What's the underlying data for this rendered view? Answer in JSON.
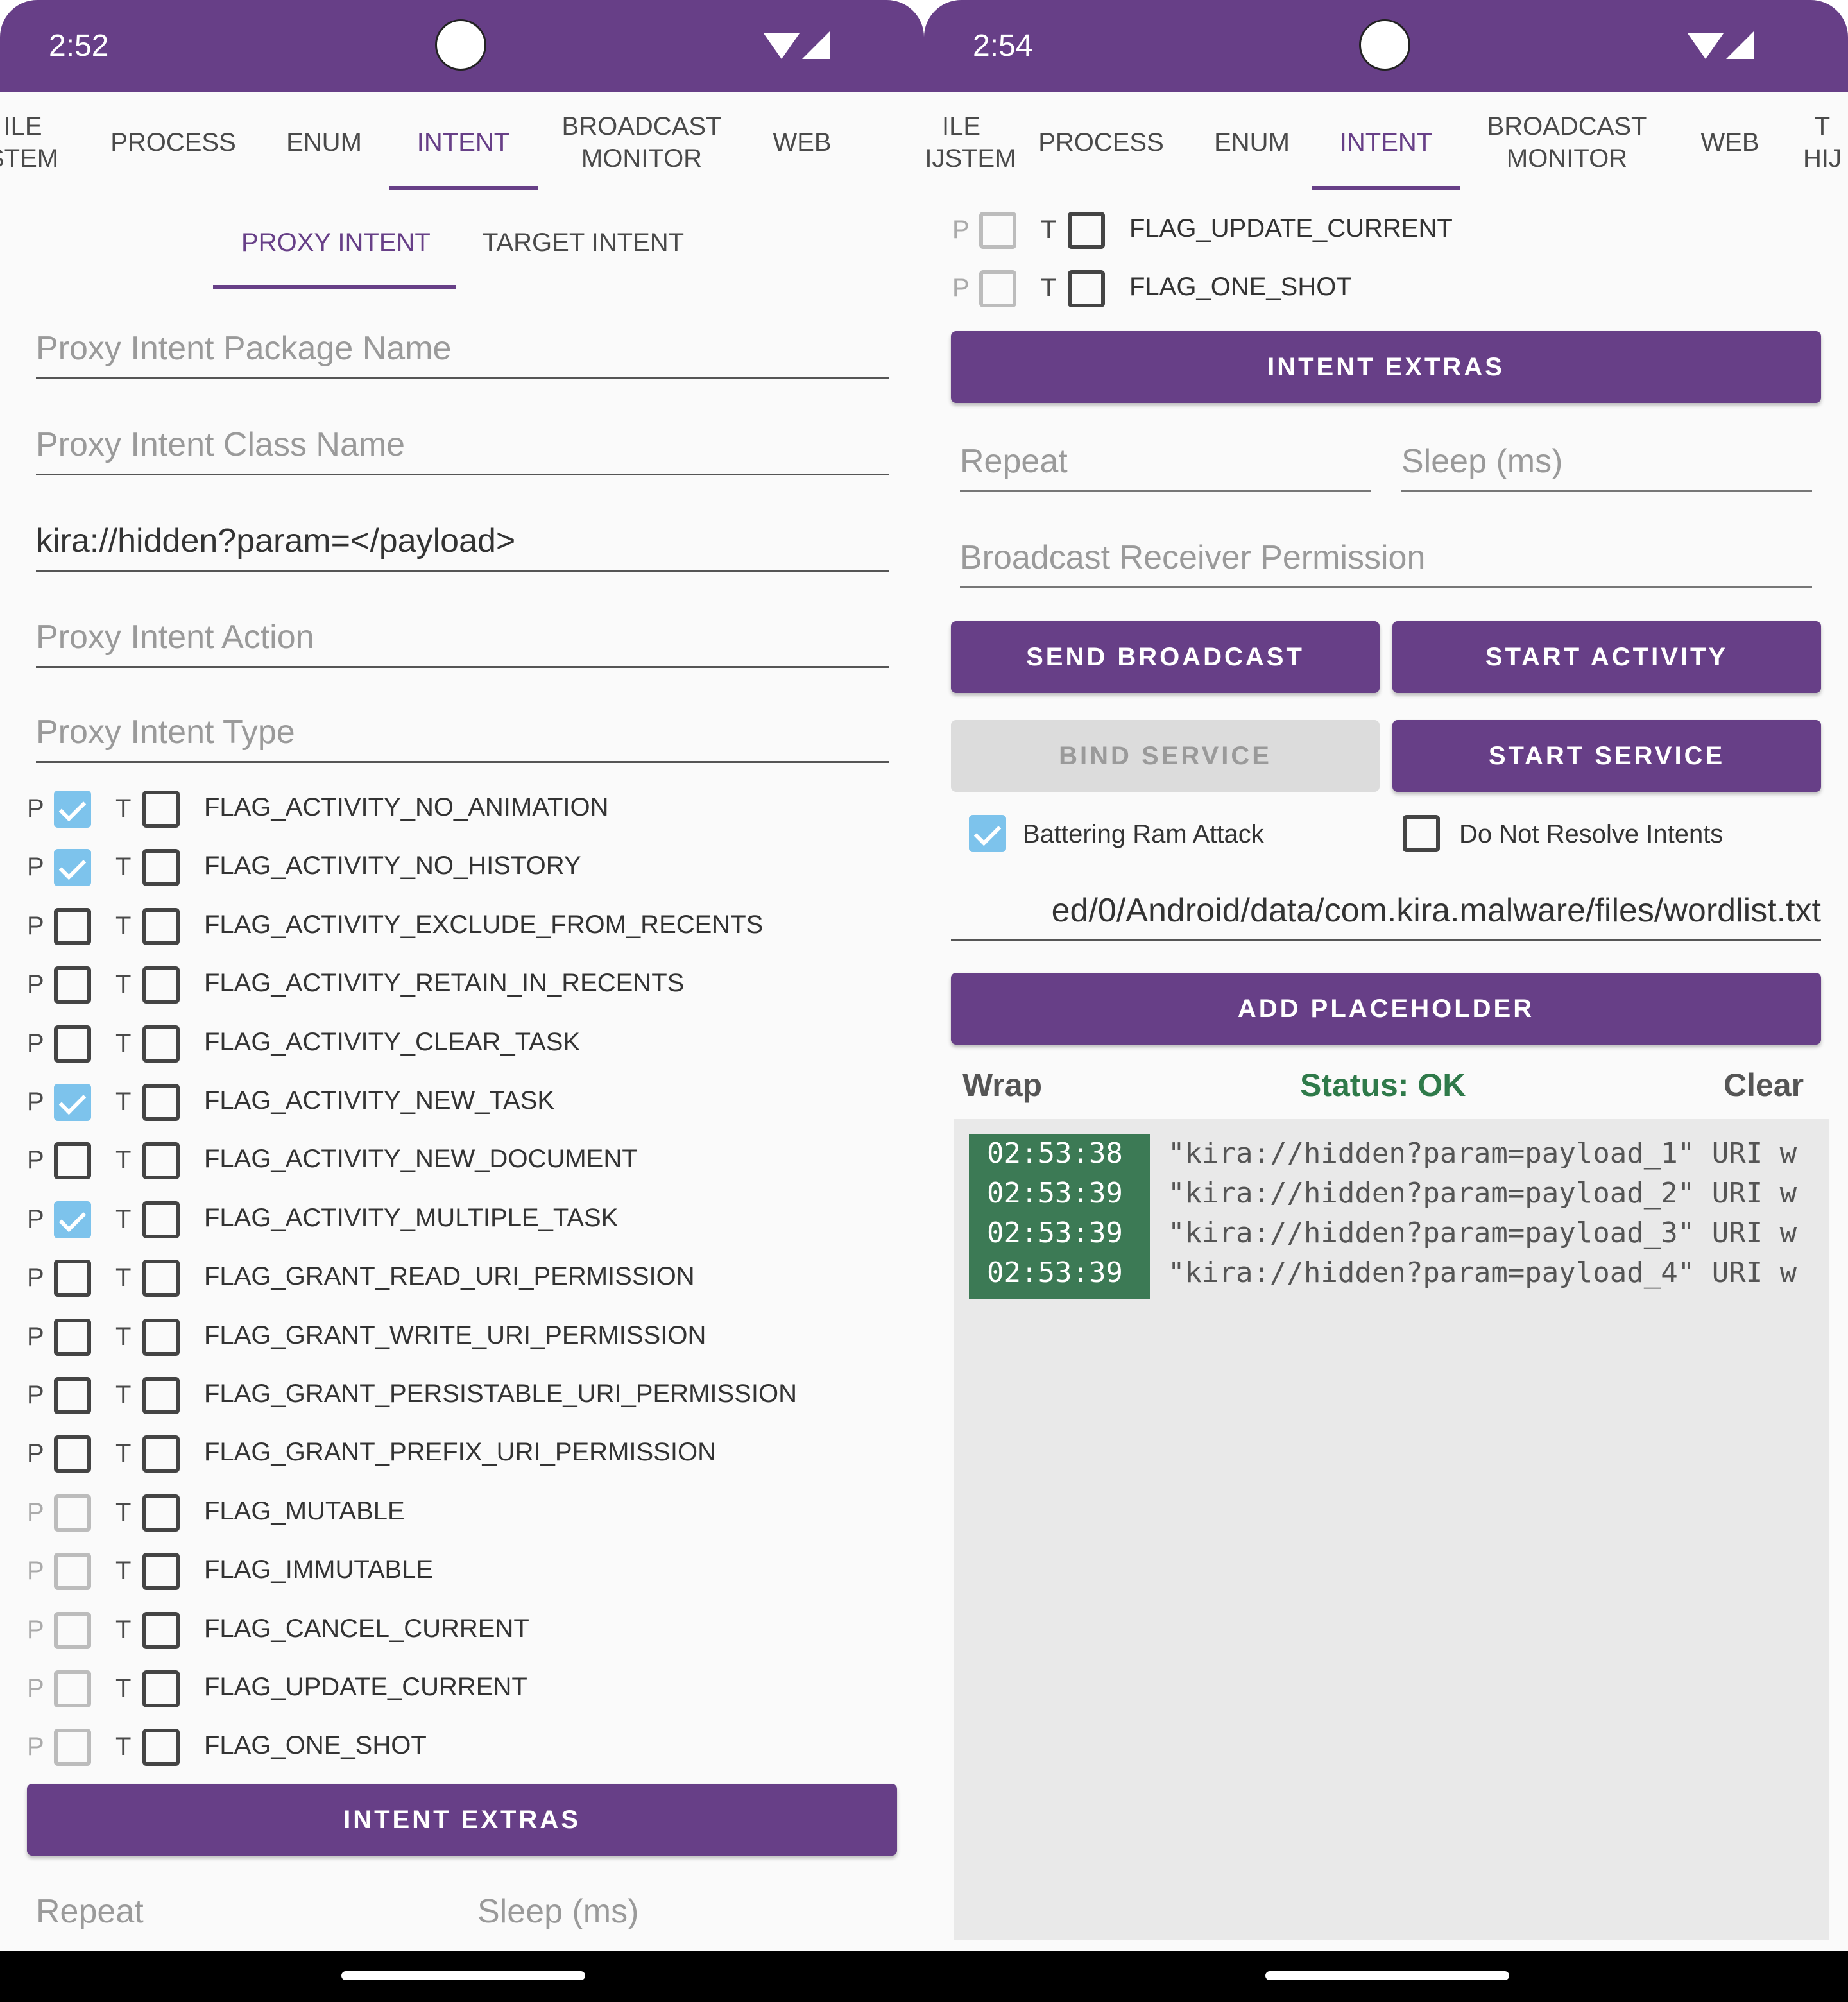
{
  "colors": {
    "accent": "#673f87",
    "status_ok": "#2f7a4a",
    "checkbox_checked": "#7dc3ec",
    "log_time_bg": "#3c7a55"
  },
  "left": {
    "status_time": "2:52",
    "tabs": [
      "ILE\nSTEM",
      "PROCESS",
      "ENUM",
      "INTENT",
      "BROADCAST\nMONITOR",
      "WEB"
    ],
    "subtabs": [
      "PROXY INTENT",
      "TARGET INTENT"
    ],
    "fields": {
      "package_placeholder": "Proxy Intent Package Name",
      "class_placeholder": "Proxy Intent Class Name",
      "data_value": "kira://hidden?param=</payload>",
      "action_placeholder": "Proxy Intent Action",
      "type_placeholder": "Proxy Intent Type"
    },
    "p_label": "P",
    "t_label": "T",
    "flags": [
      {
        "label": "FLAG_ACTIVITY_NO_ANIMATION",
        "p": true,
        "t": false,
        "p_enabled": true
      },
      {
        "label": "FLAG_ACTIVITY_NO_HISTORY",
        "p": true,
        "t": false,
        "p_enabled": true
      },
      {
        "label": "FLAG_ACTIVITY_EXCLUDE_FROM_RECENTS",
        "p": false,
        "t": false,
        "p_enabled": true
      },
      {
        "label": "FLAG_ACTIVITY_RETAIN_IN_RECENTS",
        "p": false,
        "t": false,
        "p_enabled": true
      },
      {
        "label": "FLAG_ACTIVITY_CLEAR_TASK",
        "p": false,
        "t": false,
        "p_enabled": true
      },
      {
        "label": "FLAG_ACTIVITY_NEW_TASK",
        "p": true,
        "t": false,
        "p_enabled": true
      },
      {
        "label": "FLAG_ACTIVITY_NEW_DOCUMENT",
        "p": false,
        "t": false,
        "p_enabled": true
      },
      {
        "label": "FLAG_ACTIVITY_MULTIPLE_TASK",
        "p": true,
        "t": false,
        "p_enabled": true
      },
      {
        "label": "FLAG_GRANT_READ_URI_PERMISSION",
        "p": false,
        "t": false,
        "p_enabled": true
      },
      {
        "label": "FLAG_GRANT_WRITE_URI_PERMISSION",
        "p": false,
        "t": false,
        "p_enabled": true
      },
      {
        "label": "FLAG_GRANT_PERSISTABLE_URI_PERMISSION",
        "p": false,
        "t": false,
        "p_enabled": true
      },
      {
        "label": "FLAG_GRANT_PREFIX_URI_PERMISSION",
        "p": false,
        "t": false,
        "p_enabled": true
      },
      {
        "label": "FLAG_MUTABLE",
        "p": false,
        "t": false,
        "p_enabled": false
      },
      {
        "label": "FLAG_IMMUTABLE",
        "p": false,
        "t": false,
        "p_enabled": false
      },
      {
        "label": "FLAG_CANCEL_CURRENT",
        "p": false,
        "t": false,
        "p_enabled": false
      },
      {
        "label": "FLAG_UPDATE_CURRENT",
        "p": false,
        "t": false,
        "p_enabled": false
      },
      {
        "label": "FLAG_ONE_SHOT",
        "p": false,
        "t": false,
        "p_enabled": false
      }
    ],
    "intent_extras_label": "INTENT EXTRAS",
    "repeat_placeholder": "Repeat",
    "sleep_placeholder": "Sleep (ms)"
  },
  "right": {
    "status_time": "2:54",
    "tabs": [
      "ILE\nHIJSTEM",
      "PROCESS",
      "ENUM",
      "INTENT",
      "BROADCAST\nMONITOR",
      "WEB",
      "T\nHIJ"
    ],
    "flags": [
      {
        "label": "FLAG_UPDATE_CURRENT",
        "p": false,
        "t": false,
        "p_enabled": false
      },
      {
        "label": "FLAG_ONE_SHOT",
        "p": false,
        "t": false,
        "p_enabled": false
      }
    ],
    "intent_extras_label": "INTENT EXTRAS",
    "repeat_placeholder": "Repeat",
    "sleep_placeholder": "Sleep (ms)",
    "permission_placeholder": "Broadcast Receiver Permission",
    "buttons": {
      "send_broadcast": "SEND BROADCAST",
      "start_activity": "START ACTIVITY",
      "bind_service": "BIND SERVICE",
      "start_service": "START SERVICE",
      "add_placeholder": "ADD PLACEHOLDER"
    },
    "battering_ram": {
      "label": "Battering Ram Attack",
      "checked": true
    },
    "do_not_resolve": {
      "label": "Do Not Resolve Intents",
      "checked": false
    },
    "wordlist_path": "ed/0/Android/data/com.kira.malware/files/wordlist.txt",
    "log": {
      "wrap": "Wrap",
      "status": "Status: OK",
      "clear": "Clear",
      "entries": [
        {
          "time": "02:53:38",
          "msg": "\"kira://hidden?param=payload_1\" URI w"
        },
        {
          "time": "02:53:39",
          "msg": "\"kira://hidden?param=payload_2\" URI w"
        },
        {
          "time": "02:53:39",
          "msg": "\"kira://hidden?param=payload_3\" URI w"
        },
        {
          "time": "02:53:39",
          "msg": "\"kira://hidden?param=payload_4\" URI w"
        }
      ]
    }
  }
}
